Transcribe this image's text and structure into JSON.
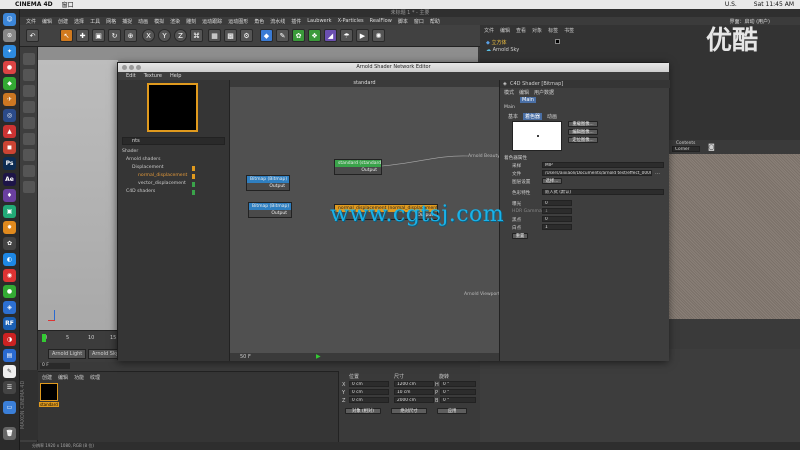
{
  "mac_menubar": {
    "app": "CINEMA 4D",
    "window_menu": "窗口",
    "status_right": "U.S.",
    "clock": "Sat 11:45 AM"
  },
  "c4d": {
    "title": "未标题 1 * - 主要",
    "menu": [
      "文件",
      "编辑",
      "创建",
      "选择",
      "工具",
      "网格",
      "捕捉",
      "动画",
      "模拟",
      "渲染",
      "雕刻",
      "运动跟踪",
      "运动图形",
      "角色",
      "流水线",
      "插件",
      "Laubwerk",
      "X-Particles",
      "RealFlow",
      "脚本",
      "窗口",
      "帮助"
    ],
    "right_menu": "界面：启动 (用户)",
    "objects": [
      {
        "name": "立方体"
      },
      {
        "name": "Arnold Sky"
      }
    ],
    "obj_tabs": [
      "文件",
      "编辑",
      "查看",
      "对象",
      "标签",
      "书签"
    ],
    "timeline_ticks": [
      "0",
      "5",
      "10",
      "15"
    ],
    "timeline_buttons": [
      "Arnold Light",
      "Arnold Sky"
    ],
    "frame_field": "0 F",
    "mat_tabs": [
      "创建",
      "编辑",
      "功能",
      "纹理"
    ],
    "material_name": "standard",
    "coord": {
      "headers": [
        "位置",
        "尺寸",
        "旋转"
      ],
      "rows": [
        {
          "axis": "X",
          "pos": "0 cm",
          "size": "1200 cm",
          "rot_label": "H",
          "rot": "0 °"
        },
        {
          "axis": "Y",
          "pos": "0 cm",
          "size": "10 cm",
          "rot_label": "P",
          "rot": "0 °"
        },
        {
          "axis": "Z",
          "pos": "0 cm",
          "size": "2000 cm",
          "rot_label": "B",
          "rot": "0 °"
        }
      ],
      "mode_left": "对象 (相对)",
      "mode_mid": "绝对尺寸",
      "apply": "应用"
    },
    "attr_right_label": "Viewport",
    "attr_right_field": "Contents",
    "attr_right_field2": "Corner",
    "status": "分辨率 1920 x 1080, RGB (8 位)"
  },
  "snw": {
    "title": "Arnold Shader Network Editor",
    "menu": [
      "Edit",
      "Texture",
      "Help"
    ],
    "search": "nts",
    "tree": [
      {
        "label": "Shader",
        "level": 0
      },
      {
        "label": "Arnold shaders",
        "level": 1
      },
      {
        "label": "Displacement",
        "level": 2
      },
      {
        "label": "normal_displacement",
        "level": 3,
        "orange": true
      },
      {
        "label": "vector_displacement",
        "level": 3
      },
      {
        "label": "C4D shaders",
        "level": 1
      }
    ],
    "canvas_title": "standard",
    "nodes": [
      {
        "title": "standard (standard)",
        "out": "Output",
        "color": "#3aa34a"
      },
      {
        "title": "Bitmap (Bitmap)",
        "out": "Output",
        "color": "#2f7fc0"
      },
      {
        "title": "Bitmap (Bitmap)",
        "out": "Output",
        "color": "#2f7fc0"
      },
      {
        "title": "normal_displacement (normal_displacement)",
        "out": "Output",
        "color": "#e09a1e"
      }
    ],
    "canvas_labels": [
      "Arnold Beauty",
      "Arnold Viewport"
    ],
    "canvas_footer": "50 F",
    "props": {
      "header": "C4D Shader [Bitmap]",
      "mode_tabs": [
        "模式",
        "编辑",
        "用户数据"
      ],
      "main_label": "Main",
      "section": "Main",
      "tabs": [
        "基本",
        "着色器",
        "动画"
      ],
      "buttons": [
        "重载图像...",
        "编辑图像...",
        "定位图像..."
      ],
      "section2": "着色器属性",
      "fields": [
        {
          "label": "采样",
          "value": "MIP"
        },
        {
          "label": "文件",
          "value": "/Users/aixiaoli/Documents/arnold test/effect_0000"
        },
        {
          "label": "图层设置",
          "value": "选择..."
        },
        {
          "label": "色彩特性",
          "value": "嵌入式 (默认)"
        },
        {
          "label": "曝光",
          "value": "0"
        },
        {
          "label": "HDR Gamma",
          "value": "1"
        },
        {
          "label": "黑点",
          "value": "0"
        },
        {
          "label": "白点",
          "value": "1"
        }
      ],
      "reset": "重置"
    }
  },
  "overlay": {
    "watermark": "www.cgtsj.com",
    "logo": "优酷"
  }
}
